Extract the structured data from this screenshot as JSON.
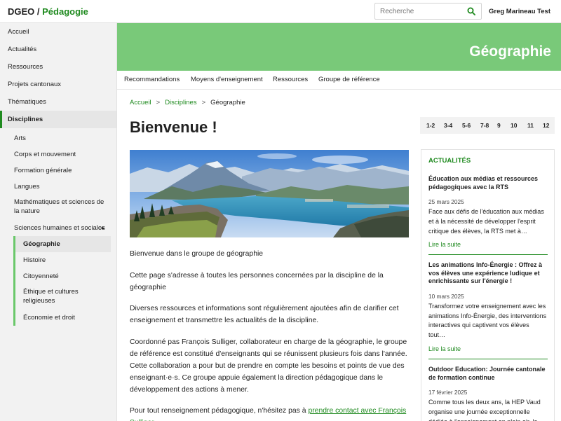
{
  "header": {
    "brand_main": "DGEO",
    "brand_sep": " / ",
    "brand_sub": "Pédagogie",
    "search_placeholder": "Recherche",
    "user": "Greg Marineau Test"
  },
  "sidebar": {
    "top_items": [
      "Accueil",
      "Actualités",
      "Ressources",
      "Projets cantonaux",
      "Thématiques"
    ],
    "active_item": "Disciplines",
    "sub_items": [
      "Arts",
      "Corps et mouvement",
      "Formation générale",
      "Langues",
      "Mathématiques et sciences de la nature",
      "Sciences humaines et sociales"
    ],
    "expanded_arrow": "▲",
    "subsub_items": [
      "Géographie",
      "Histoire",
      "Citoyenneté",
      "Éthique et cultures religieuses",
      "Économie et droit"
    ]
  },
  "banner": {
    "title": "Géographie"
  },
  "subnav": [
    "Recommandations",
    "Moyens d'enseignement",
    "Ressources",
    "Groupe de référence"
  ],
  "breadcrumb": {
    "home": "Accueil",
    "sep": ">",
    "section": "Disciplines",
    "current": "Géographie"
  },
  "page_title": "Bienvenue !",
  "grades": [
    "1-2",
    "3-4",
    "5-6",
    "7-8",
    "9",
    "10",
    "11",
    "12"
  ],
  "article": {
    "p1": "Bienvenue dans le groupe de géographie",
    "p2": "Cette page s'adresse à toutes les personnes concernées par la discipline de la géographie",
    "p3": "Diverses ressources et informations sont régulièrement ajoutées afin de clarifier cet enseignement et transmettre les actualités de la discipline.",
    "p4": "Coordonné pas François Sulliger, collaborateur en charge de la géographie, le groupe de référence est constitué d'enseignants qui se réunissent plusieurs fois dans l'année. Cette collaboration a pour but de prendre en compte les besoins et points de vue des enseignant·e·s. Ce groupe appuie également la direction pédagogique dans le développement des actions à mener.",
    "p5_text": "Pour tout renseignement pédagogique, n'hésitez pas à ",
    "p5_link": "prendre contact avec François Sulliger"
  },
  "news": {
    "heading": "ACTUALITÉS",
    "read_more": "Lire la suite",
    "items": [
      {
        "title": "Éducation aux médias et ressources pédagogiques avec la RTS",
        "date": "25 mars 2025",
        "text": "Face aux défis de l'éducation aux médias et à la nécessité de développer l'esprit critique des élèves, la RTS met à…"
      },
      {
        "title": "Les animations Info-Énergie : Offrez à vos élèves une expérience ludique et enrichissante sur l'énergie !",
        "date": "10 mars 2025",
        "text": "Transformez votre enseignement avec les animations Info-Énergie, des interventions interactives qui captivent vos élèves tout…"
      },
      {
        "title": "Outdoor Education: Journée cantonale de formation continue",
        "date": "17 février 2025",
        "text": "Comme tous les deux ans, la HEP Vaud organise une journée exceptionnelle dédiée à l'enseignement en plein air, le…"
      }
    ]
  },
  "colors": {
    "accent": "#1f8a1f",
    "banner": "#79c979",
    "subnav_border": "#6ac86a"
  }
}
